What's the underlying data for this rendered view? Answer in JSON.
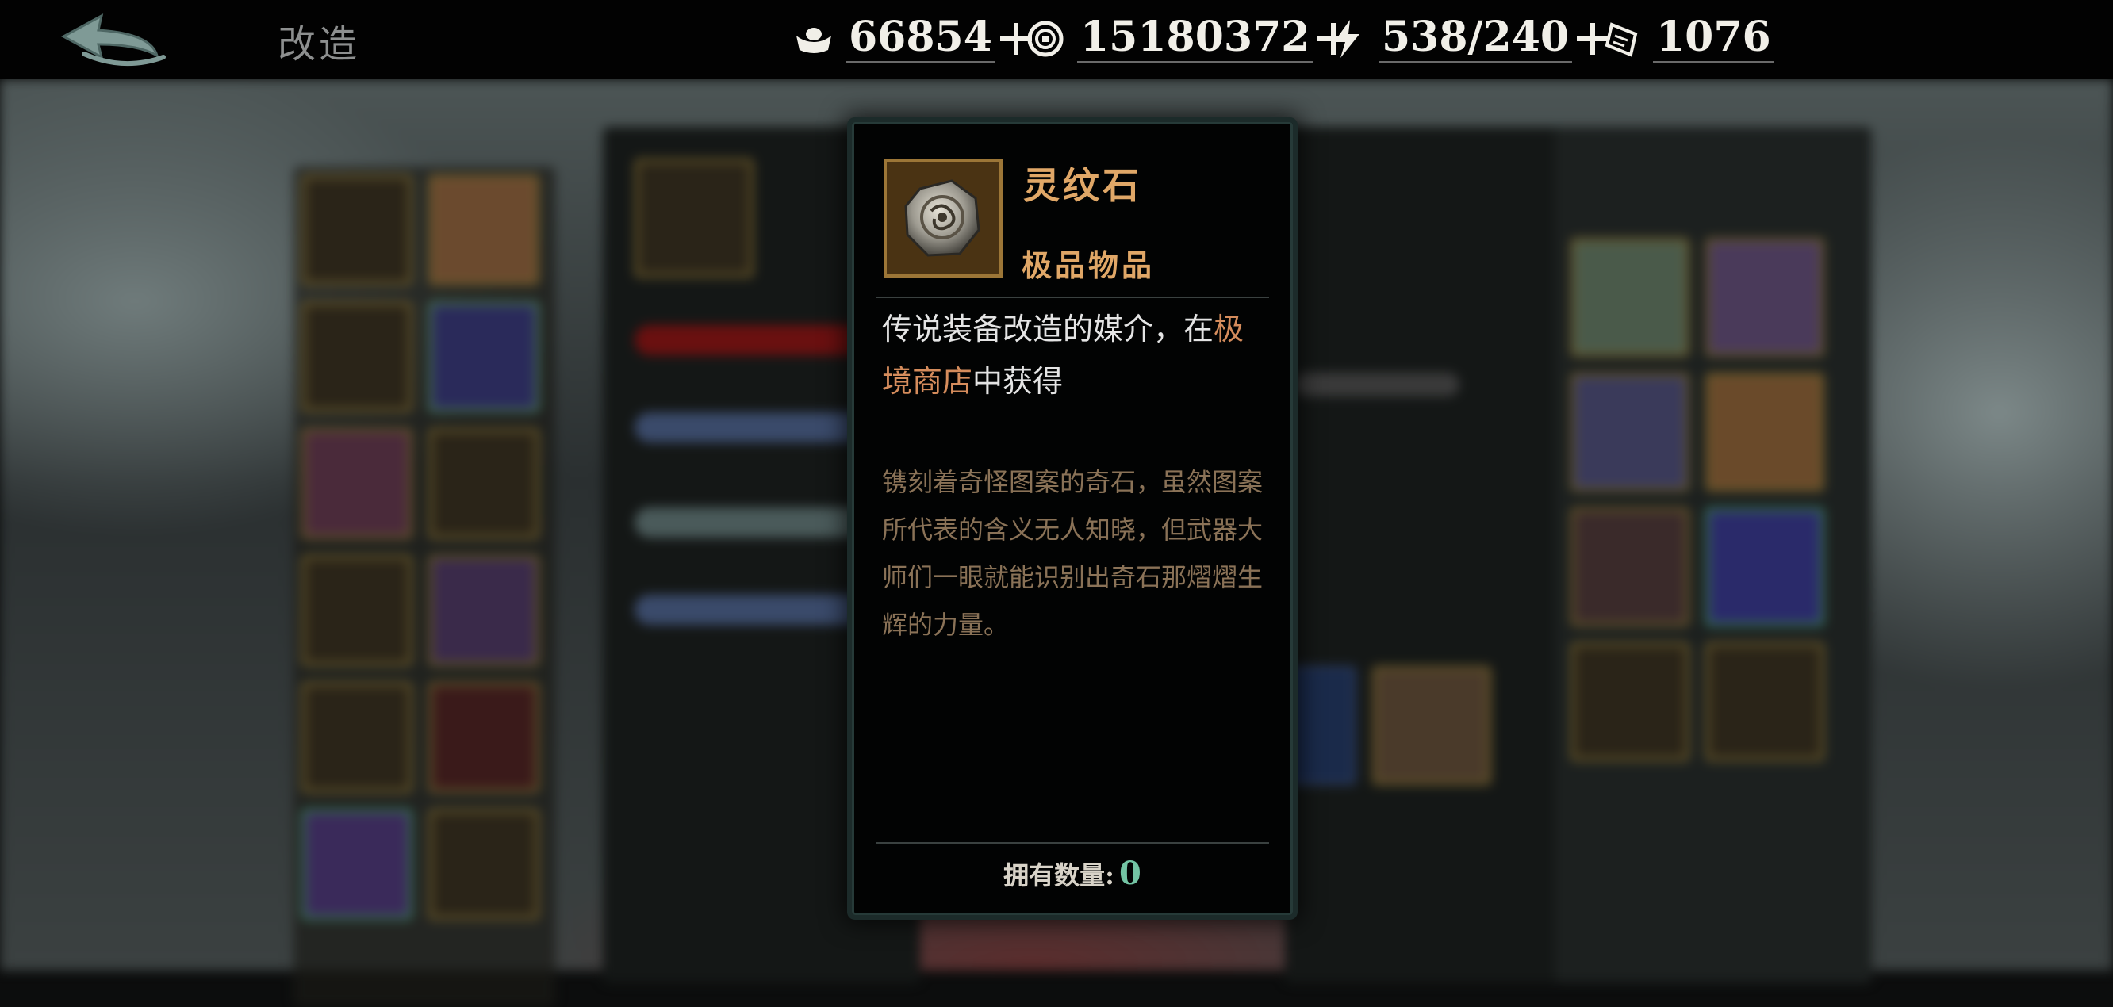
{
  "header": {
    "title": "改造",
    "resources": [
      {
        "icon": "ingot-icon",
        "value": "66854",
        "has_add": true
      },
      {
        "icon": "coin-icon",
        "value": "15180372",
        "has_add": true
      },
      {
        "icon": "lightning-icon",
        "value": "538/240",
        "has_add": true
      },
      {
        "icon": "ticket-icon",
        "value": "1076",
        "has_add": false
      }
    ]
  },
  "tooltip": {
    "item_name": "灵纹石",
    "rarity": "极品物品",
    "description_parts": [
      "传说装备改造的媒介，在",
      "极境商店",
      "中获得"
    ],
    "lore": "镌刻着奇怪图案的奇石，虽然图案所代表的含义无人知晓，但武器大师们一眼就能识别出奇石那熠熠生辉的力量。",
    "quantity_label": "拥有数量:",
    "quantity_value": "0"
  },
  "colors": {
    "rarity_orange": "#e0a767",
    "highlight": "#d58c5c",
    "lore_brown": "#8a7257",
    "quantity_green": "#73c4a4"
  }
}
